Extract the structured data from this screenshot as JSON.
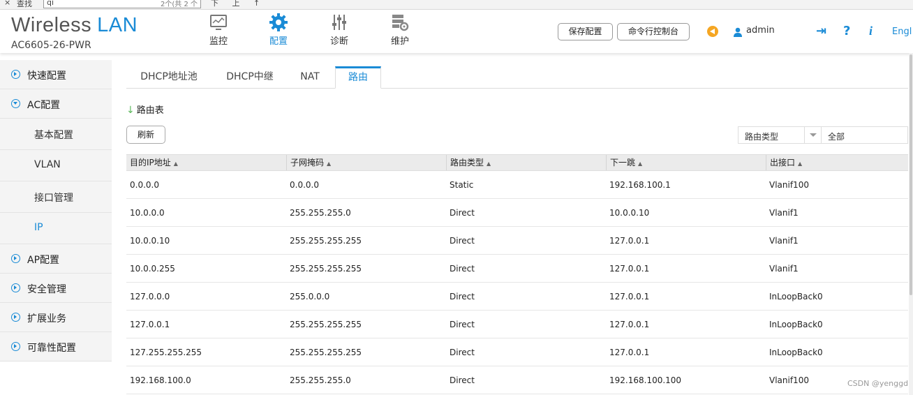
{
  "findbar": {
    "close_glyph": "×",
    "label": "查找",
    "query": "qi",
    "count": "2个(共 2 个",
    "nav": "下 上 ↑"
  },
  "header": {
    "brand_main": "Wireless",
    "brand_accent": "LAN",
    "model": "AC6605-26-PWR",
    "accent_color": "#1a8bd6",
    "nav": [
      {
        "label": "监控",
        "icon": "monitor-icon",
        "active": false
      },
      {
        "label": "配置",
        "icon": "gear-icon",
        "active": true
      },
      {
        "label": "诊断",
        "icon": "sliders-icon",
        "active": false
      },
      {
        "label": "维护",
        "icon": "server-gear-icon",
        "active": false
      }
    ],
    "save_config": "保存配置",
    "cli_console": "命令行控制台",
    "user": "admin",
    "help_glyph": "?",
    "info_glyph": "i",
    "logout_glyph": "⇥",
    "language": "Engl"
  },
  "sidebar": {
    "items": [
      {
        "label": "快速配置",
        "expanded": false
      },
      {
        "label": "AC配置",
        "expanded": true
      },
      {
        "label": "AP配置",
        "expanded": false
      },
      {
        "label": "安全管理",
        "expanded": false
      },
      {
        "label": "扩展业务",
        "expanded": false
      },
      {
        "label": "可靠性配置",
        "expanded": false
      }
    ],
    "ac_children": [
      {
        "label": "基本配置",
        "active": false
      },
      {
        "label": "VLAN",
        "active": false
      },
      {
        "label": "接口管理",
        "active": false
      },
      {
        "label": "IP",
        "active": true
      }
    ]
  },
  "main": {
    "tabs": [
      {
        "label": "DHCP地址池",
        "active": false
      },
      {
        "label": "DHCP中继",
        "active": false
      },
      {
        "label": "NAT",
        "active": false
      },
      {
        "label": "路由",
        "active": true
      }
    ],
    "section_arrow": "↓",
    "section_title": "路由表",
    "refresh": "刷新",
    "filter_type": "路由类型",
    "filter_value": "全部",
    "columns": [
      "目的IP地址",
      "子网掩码",
      "路由类型",
      "下一跳",
      "出接口"
    ],
    "sort_glyph": "▲",
    "rows": [
      [
        "0.0.0.0",
        "0.0.0.0",
        "Static",
        "192.168.100.1",
        "Vlanif100"
      ],
      [
        "10.0.0.0",
        "255.255.255.0",
        "Direct",
        "10.0.0.10",
        "Vlanif1"
      ],
      [
        "10.0.0.10",
        "255.255.255.255",
        "Direct",
        "127.0.0.1",
        "Vlanif1"
      ],
      [
        "10.0.0.255",
        "255.255.255.255",
        "Direct",
        "127.0.0.1",
        "Vlanif1"
      ],
      [
        "127.0.0.0",
        "255.0.0.0",
        "Direct",
        "127.0.0.1",
        "InLoopBack0"
      ],
      [
        "127.0.0.1",
        "255.255.255.255",
        "Direct",
        "127.0.0.1",
        "InLoopBack0"
      ],
      [
        "127.255.255.255",
        "255.255.255.255",
        "Direct",
        "127.0.0.1",
        "InLoopBack0"
      ],
      [
        "192.168.100.0",
        "255.255.255.0",
        "Direct",
        "192.168.100.100",
        "Vlanif100"
      ]
    ]
  },
  "watermark": "CSDN @yenggd"
}
